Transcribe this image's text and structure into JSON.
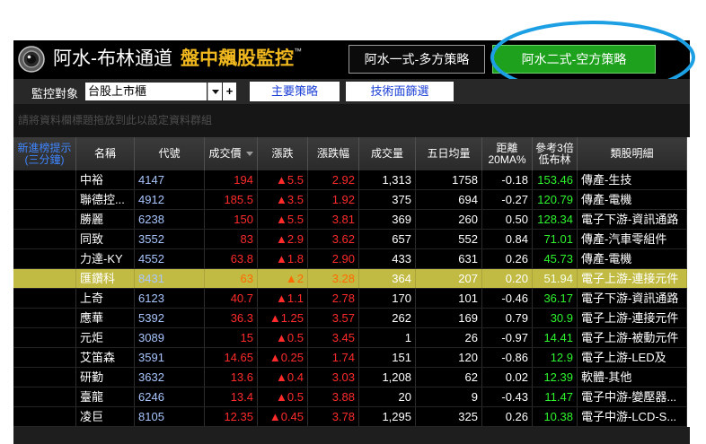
{
  "colors": {
    "up": "#ff2b2b",
    "boll": "#2ef52e",
    "gold": "#f0b81e",
    "accent_green": "#1ea21e",
    "highlight": "#c2bb43",
    "annotation": "#1c9fe3"
  },
  "header": {
    "title": "阿水-布林通道",
    "subtitle": "盤中飆股監控",
    "tm": "™",
    "strategy_buttons": [
      {
        "label": "阿水一式-多方策略"
      },
      {
        "label": "阿水二式-空方策略"
      }
    ]
  },
  "toolbar": {
    "monitor_label": "監控對象",
    "monitor_value": "台股上市櫃",
    "add_label": "+",
    "main_strategy": "主要策略",
    "tech_filter": "技術面篩選"
  },
  "group_hint": "請將資料欄標題拖放到此以設定資料群組",
  "table": {
    "columns": [
      {
        "label": [
          "新進榜提示",
          "(三分鐘)"
        ]
      },
      {
        "label": [
          "名稱"
        ]
      },
      {
        "label": [
          "代號"
        ]
      },
      {
        "label": [
          "成交價"
        ]
      },
      {
        "label": [
          "漲跌"
        ]
      },
      {
        "label": [
          "漲跌幅"
        ]
      },
      {
        "label": [
          "成交量"
        ]
      },
      {
        "label": [
          "五日均量"
        ]
      },
      {
        "label": [
          "距離",
          "20MA%"
        ]
      },
      {
        "label": [
          "參考3倍",
          "低布林"
        ]
      },
      {
        "label": [
          "類股明細"
        ]
      }
    ],
    "sorted_column": "成交價",
    "sort_direction": "desc",
    "rows": [
      {
        "name": "中裕",
        "code": "4147",
        "price": "194",
        "change": "▲5.5",
        "change_pct": "2.92",
        "volume": "1,313",
        "avg5_volume": "1758",
        "dist_20ma": "-0.18",
        "boll_ref": "153.46",
        "sector": "傳產-生技"
      },
      {
        "name": "聯德控...",
        "code": "4912",
        "price": "185.5",
        "change": "▲3.5",
        "change_pct": "1.92",
        "volume": "375",
        "avg5_volume": "694",
        "dist_20ma": "-0.27",
        "boll_ref": "120.79",
        "sector": "傳產-電機"
      },
      {
        "name": "勝麗",
        "code": "6238",
        "price": "150",
        "change": "▲5.5",
        "change_pct": "3.81",
        "volume": "369",
        "avg5_volume": "260",
        "dist_20ma": "0.50",
        "boll_ref": "128.34",
        "sector": "電子下游-資訊通路"
      },
      {
        "name": "同致",
        "code": "3552",
        "price": "83",
        "change": "▲2.9",
        "change_pct": "3.62",
        "volume": "657",
        "avg5_volume": "552",
        "dist_20ma": "0.84",
        "boll_ref": "71.01",
        "sector": "傳產-汽車零組件"
      },
      {
        "name": "力達-KY",
        "code": "4552",
        "price": "63.8",
        "change": "▲1.8",
        "change_pct": "2.90",
        "volume": "433",
        "avg5_volume": "631",
        "dist_20ma": "0.26",
        "boll_ref": "45.73",
        "sector": "傳產-電機"
      },
      {
        "name": "匯鑽科",
        "code": "8431",
        "price": "63",
        "change": "▲2",
        "change_pct": "3.28",
        "volume": "364",
        "avg5_volume": "207",
        "dist_20ma": "0.20",
        "boll_ref": "51.94",
        "sector": "電子上游-連接元件",
        "selected": true
      },
      {
        "name": "上奇",
        "code": "6123",
        "price": "40.7",
        "change": "▲1.1",
        "change_pct": "2.78",
        "volume": "170",
        "avg5_volume": "101",
        "dist_20ma": "-0.46",
        "boll_ref": "36.17",
        "sector": "電子下游-資訊通路"
      },
      {
        "name": "應華",
        "code": "5392",
        "price": "36.3",
        "change": "▲1.25",
        "change_pct": "3.57",
        "volume": "262",
        "avg5_volume": "169",
        "dist_20ma": "0.79",
        "boll_ref": "30.9",
        "sector": "電子上游-連接元件"
      },
      {
        "name": "元炬",
        "code": "3089",
        "price": "15",
        "change": "▲0.5",
        "change_pct": "3.45",
        "volume": "1",
        "avg5_volume": "26",
        "dist_20ma": "-0.97",
        "boll_ref": "14.41",
        "sector": "電子上游-被動元件"
      },
      {
        "name": "艾笛森",
        "code": "3591",
        "price": "14.65",
        "change": "▲0.25",
        "change_pct": "1.74",
        "volume": "151",
        "avg5_volume": "120",
        "dist_20ma": "-0.86",
        "boll_ref": "12.9",
        "sector": "電子上游-LED及"
      },
      {
        "name": "研勤",
        "code": "3632",
        "price": "13.6",
        "change": "▲0.4",
        "change_pct": "3.03",
        "volume": "1,208",
        "avg5_volume": "62",
        "dist_20ma": "0.02",
        "boll_ref": "12.39",
        "sector": "軟體-其他"
      },
      {
        "name": "臺龍",
        "code": "6246",
        "price": "13.4",
        "change": "▲0.5",
        "change_pct": "3.88",
        "volume": "20",
        "avg5_volume": "9",
        "dist_20ma": "-0.43",
        "boll_ref": "11.47",
        "sector": "電子中游-變壓器..."
      },
      {
        "name": "凌巨",
        "code": "8105",
        "price": "12.35",
        "change": "▲0.45",
        "change_pct": "3.78",
        "volume": "1,295",
        "avg5_volume": "325",
        "dist_20ma": "0.26",
        "boll_ref": "10.38",
        "sector": "電子中游-LCD-S..."
      }
    ]
  }
}
